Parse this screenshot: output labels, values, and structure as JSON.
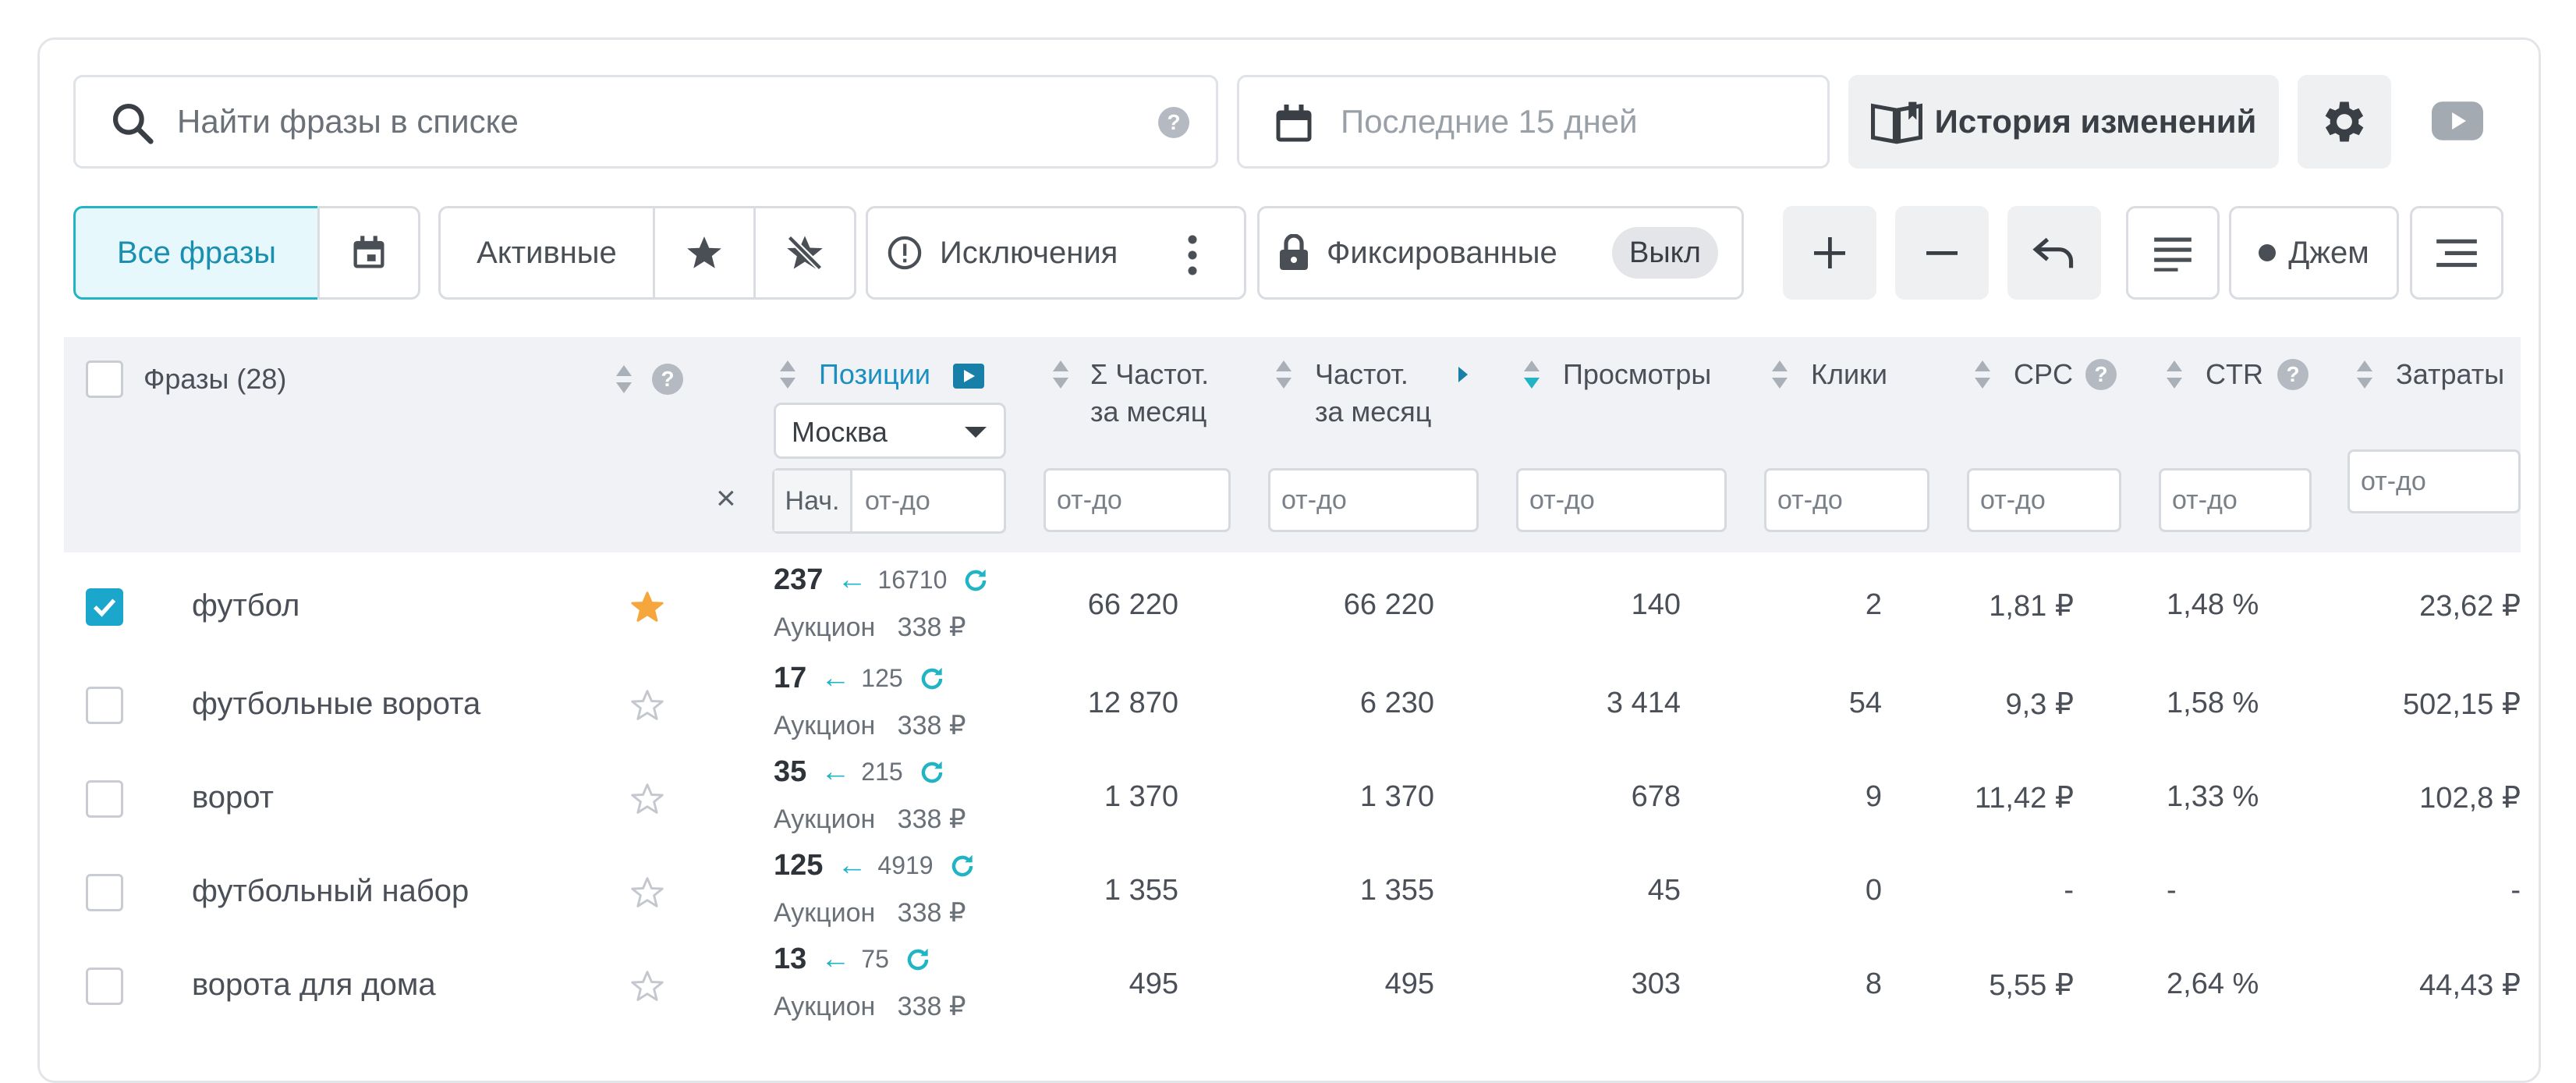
{
  "search": {
    "placeholder": "Найти фразы в списке",
    "help": "?"
  },
  "date": {
    "placeholder": "Последние 15 дней"
  },
  "history": {
    "label": "История изменений"
  },
  "filters": {
    "all": "Все фразы",
    "active": "Активные",
    "exclusions": "Исключения",
    "fixed": "Фиксированные",
    "fixed_state": "Выкл",
    "jam": "Джем"
  },
  "table": {
    "headers": {
      "phrases": "Фразы (28)",
      "positions": "Позиции",
      "region": "Москва",
      "freq_sum_1": "Σ Частот.",
      "freq_sum_2": "за месяц",
      "freq_1": "Частот.",
      "freq_2": "за месяц",
      "views": "Просмотры",
      "clicks": "Клики",
      "cpc": "CPC",
      "ctr": "CTR",
      "cost": "Затраты"
    },
    "filter_placeholder": "от-до",
    "start_label": "Нач.",
    "clear": "×",
    "rows": [
      {
        "phrase": "футбол",
        "checked": true,
        "starred": true,
        "pos": "237",
        "prev": "16710",
        "auction": "Аукцион   338 ₽",
        "freq_sum": "66 220",
        "freq": "66 220",
        "views": "140",
        "clicks": "2",
        "cpc": "1,81 ₽",
        "ctr": "1,48 %",
        "cost": "23,62 ₽"
      },
      {
        "phrase": "футбольные ворота",
        "checked": false,
        "starred": false,
        "pos": "17",
        "prev": "125",
        "auction": "Аукцион   338 ₽",
        "freq_sum": "12 870",
        "freq": "6 230",
        "views": "3 414",
        "clicks": "54",
        "cpc": "9,3 ₽",
        "ctr": "1,58 %",
        "cost": "502,15 ₽"
      },
      {
        "phrase": "ворот",
        "checked": false,
        "starred": false,
        "pos": "35",
        "prev": "215",
        "auction": "Аукцион   338 ₽",
        "freq_sum": "1 370",
        "freq": "1 370",
        "views": "678",
        "clicks": "9",
        "cpc": "11,42 ₽",
        "ctr": "1,33 %",
        "cost": "102,8 ₽"
      },
      {
        "phrase": "футбольный набор",
        "checked": false,
        "starred": false,
        "pos": "125",
        "prev": "4919",
        "auction": "Аукцион   338 ₽",
        "freq_sum": "1 355",
        "freq": "1 355",
        "views": "45",
        "clicks": "0",
        "cpc": "-",
        "ctr": "-",
        "cost": "-"
      },
      {
        "phrase": "ворота для дома",
        "checked": false,
        "starred": false,
        "pos": "13",
        "prev": "75",
        "auction": "Аукцион   338 ₽",
        "freq_sum": "495",
        "freq": "495",
        "views": "303",
        "clicks": "8",
        "cpc": "5,55 ₽",
        "ctr": "2,64 %",
        "cost": "44,43 ₽"
      }
    ]
  },
  "icons": {
    "search": "search-icon",
    "calendar": "calendar-icon",
    "history": "book-icon",
    "settings": "gear-icon",
    "video": "youtube-icon",
    "star": "star-icon",
    "lock": "lock-icon",
    "refresh": "refresh-icon",
    "arrow": "arrow-left-icon"
  },
  "colors": {
    "accent": "#1ba6cc",
    "teal": "#20b4c4",
    "star": "#f5a63c",
    "active_bg": "#e6f8fb"
  }
}
